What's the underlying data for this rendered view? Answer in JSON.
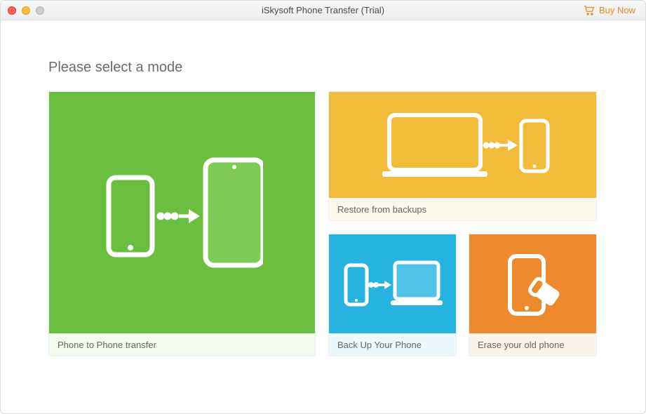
{
  "titlebar": {
    "title": "iSkysoft Phone Transfer (Trial)",
    "buy_now": "Buy Now"
  },
  "heading": "Please select a mode",
  "cards": {
    "phone_to_phone": "Phone to Phone transfer",
    "restore": "Restore from backups",
    "backup": "Back Up Your Phone",
    "erase": "Erase your old phone"
  }
}
